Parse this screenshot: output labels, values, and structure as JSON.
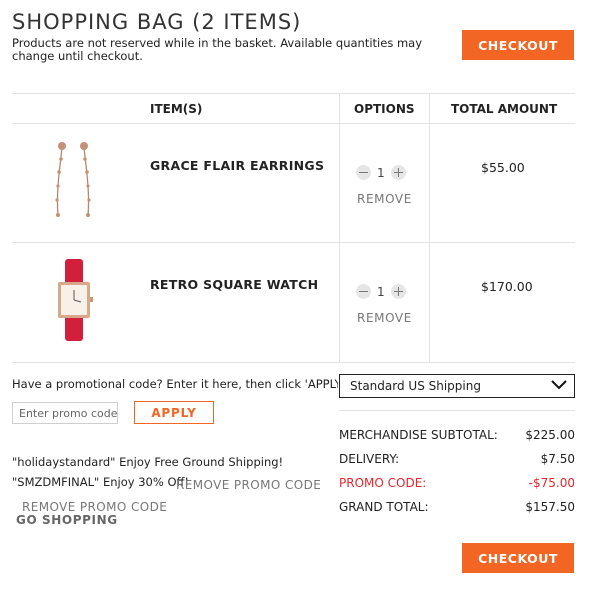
{
  "header": {
    "title": "SHOPPING BAG (2 ITEMS)",
    "subtitle": "Products are not reserved while in the basket. Available quantities may change until checkout.",
    "checkout_label": "CHECKOUT"
  },
  "table": {
    "columns": [
      "ITEM(S)",
      "OPTIONS",
      "TOTAL AMOUNT"
    ],
    "items": [
      {
        "name": "GRACE FLAIR EARRINGS",
        "qty": "1",
        "remove_label": "REMOVE",
        "total": "$55.00",
        "image_icon": "earrings-image"
      },
      {
        "name": "RETRO SQUARE WATCH",
        "qty": "1",
        "remove_label": "REMOVE",
        "total": "$170.00",
        "image_icon": "watch-image"
      }
    ]
  },
  "promo": {
    "prompt": "Have a promotional code? Enter it here, then click 'APPLY'",
    "placeholder": "Enter promo code",
    "apply_label": "APPLY",
    "applied": [
      {
        "text": "\"holidaystandard\" Enjoy Free Ground Shipping!",
        "remove_label": "REMOVE PROMO CODE"
      },
      {
        "text": "\"SMZDMFINAL\" Enjoy 30% Off!",
        "remove_label": "REMOVE PROMO CODE"
      }
    ],
    "go_shopping_label": "GO SHOPPING"
  },
  "shipping": {
    "selected": "Standard US Shipping"
  },
  "summary": {
    "rows": [
      {
        "label": "MERCHANDISE SUBTOTAL:",
        "value": "$225.00"
      },
      {
        "label": "DELIVERY:",
        "value": "$7.50"
      },
      {
        "label": "PROMO CODE:",
        "value": "-$75.00"
      },
      {
        "label": "GRAND TOTAL:",
        "value": "$157.50"
      }
    ],
    "checkout_label": "CHECKOUT"
  },
  "colors": {
    "accent": "#f26522",
    "promo_red": "#e8262d",
    "watch_strap": "#d21f3c"
  }
}
